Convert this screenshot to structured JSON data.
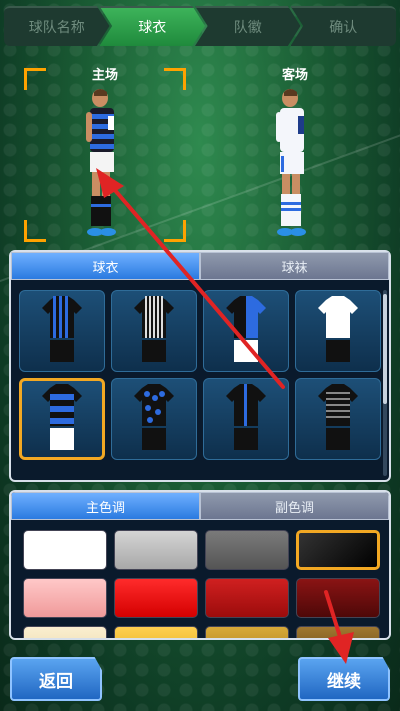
{
  "steps": [
    {
      "label": "球队名称"
    },
    {
      "label": "球衣"
    },
    {
      "label": "队徽"
    },
    {
      "label": "确认"
    }
  ],
  "preview": {
    "home_label": "主场",
    "away_label": "客场"
  },
  "kit_tabs": {
    "jersey": "球衣",
    "socks": "球袜"
  },
  "color_tabs": {
    "primary": "主色调",
    "secondary": "副色调"
  },
  "buttons": {
    "back": "返回",
    "continue": "继续"
  },
  "colors": {
    "accent": "#f2a823",
    "swatches": [
      "#ffffff",
      "#b8b8b8",
      "#6a6a6a",
      "#111111",
      "#f3a9a9",
      "#e81010",
      "#b80f0f",
      "#6e0c0c",
      "#f4e7c8",
      "#f2c23a",
      "#c89a28",
      "#8a6a20"
    ]
  }
}
